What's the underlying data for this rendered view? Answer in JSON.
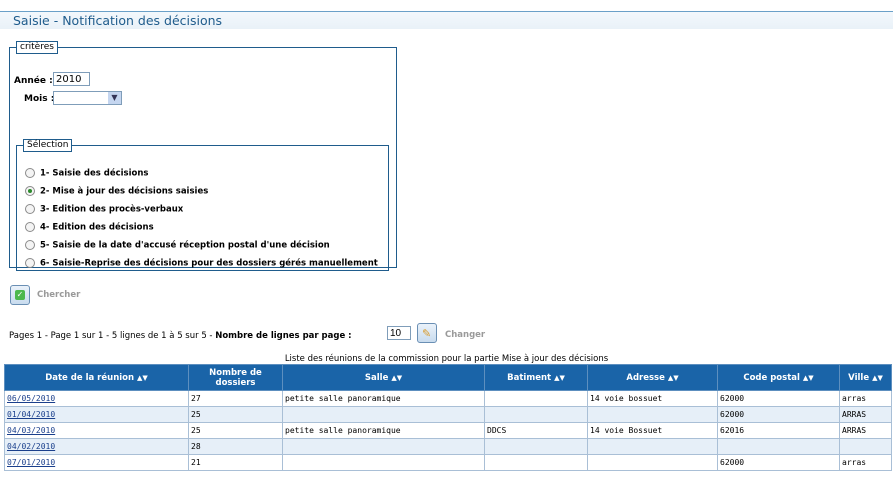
{
  "page": {
    "title": "Saisie - Notification des décisions"
  },
  "criteres": {
    "legend": "critères",
    "annee_label": "Année :",
    "annee_value": "2010",
    "mois_label": "Mois :",
    "mois_value": ""
  },
  "selection": {
    "legend": "Sélection",
    "options": [
      {
        "label": "1- Saisie des décisions",
        "checked": false
      },
      {
        "label": "2- Mise à jour des décisions saisies",
        "checked": true
      },
      {
        "label": "3- Edition des procès-verbaux",
        "checked": false
      },
      {
        "label": "4- Edition des décisions",
        "checked": false
      },
      {
        "label": "5- Saisie de la date d'accusé réception postal d'une décision",
        "checked": false
      },
      {
        "label": "6- Saisie-Reprise des décisions pour des dossiers gérés manuellement",
        "checked": false
      }
    ]
  },
  "search": {
    "label": "Chercher"
  },
  "pager": {
    "text": "Pages  1 - Page 1 sur 1 - 5 lignes de 1 à 5 sur 5 - ",
    "lines_label": "Nombre de lignes par page :",
    "lines_value": "10",
    "change_label": "Changer"
  },
  "table": {
    "caption": "Liste des réunions de la commission pour la partie Mise à jour des décisions",
    "headers": {
      "date": "Date de la réunion",
      "nombre": "Nombre de dossiers",
      "salle": "Salle",
      "batiment": "Batiment",
      "adresse": "Adresse",
      "code_postal": "Code postal",
      "ville": "Ville"
    },
    "sort_icon": "sort-arrows-icon",
    "rows": [
      {
        "date": "06/05/2010",
        "nombre": "27",
        "salle": "petite salle panoramique",
        "batiment": "",
        "adresse": "14 voie bossuet",
        "code_postal": "62000",
        "ville": "arras"
      },
      {
        "date": "01/04/2010",
        "nombre": "25",
        "salle": "",
        "batiment": "",
        "adresse": "",
        "code_postal": "62000",
        "ville": "ARRAS"
      },
      {
        "date": "04/03/2010",
        "nombre": "25",
        "salle": "petite salle panoramique",
        "batiment": "DDCS",
        "adresse": "14 voie Bossuet",
        "code_postal": "62016",
        "ville": "ARRAS"
      },
      {
        "date": "04/02/2010",
        "nombre": "28",
        "salle": "",
        "batiment": "",
        "adresse": "",
        "code_postal": "",
        "ville": ""
      },
      {
        "date": "07/01/2010",
        "nombre": "21",
        "salle": "",
        "batiment": "",
        "adresse": "",
        "code_postal": "62000",
        "ville": "arras"
      }
    ]
  }
}
